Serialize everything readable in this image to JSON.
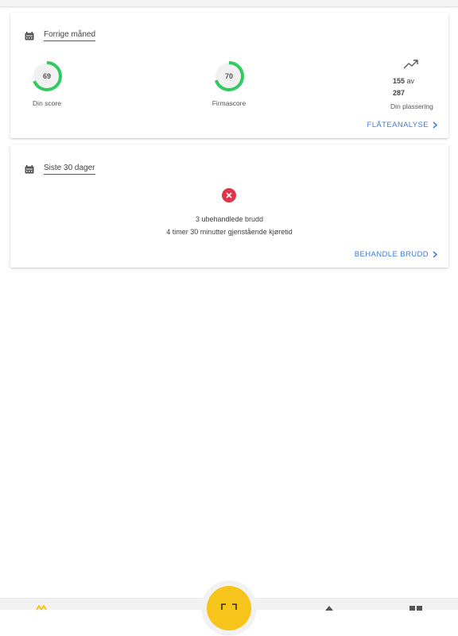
{
  "previous_month": {
    "period_label": "Forrige måned",
    "score": {
      "value": "69",
      "label": "Din score",
      "fraction": 0.69
    },
    "company_score": {
      "value": "70",
      "label": "Firmascore",
      "fraction": 0.7
    },
    "ranking": {
      "position": "155",
      "separator": "av",
      "total": "287",
      "label": "Din plassering"
    },
    "action_label": "FLÅTEANALYSE"
  },
  "last_30_days": {
    "period_label": "Siste 30 dager",
    "violations_text": "3 ubehandlede brudd",
    "remaining_text": "4 timer 30 minutter gjenstående kjøretid",
    "action_label": "BEHANDLE BRUDD"
  },
  "colors": {
    "accent": "#3d7bd8",
    "ring": "#2ecc5f",
    "error": "#e0344c",
    "fab": "#f6c41a"
  }
}
